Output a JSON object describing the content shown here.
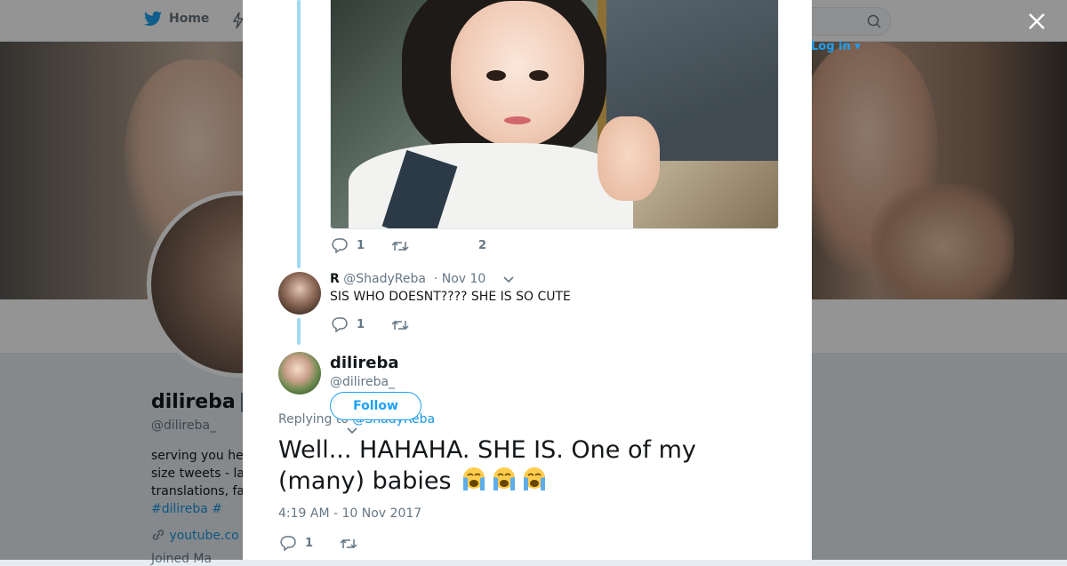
{
  "nav": {
    "home_label": "Home",
    "login_label": "Log in"
  },
  "profile": {
    "name": "dilireba",
    "handle": "@dilireba_",
    "bio_lines": [
      "serving you he",
      "size tweets - la",
      "translations, fa"
    ],
    "hashtags": "#dilireba #",
    "link": "youtube.co",
    "joined": "Joined Ma"
  },
  "modal": {
    "media_tweet_actions": {
      "reply_count": "1",
      "like_count": "2"
    },
    "reply_tweet": {
      "name": "R",
      "handle": "@ShadyReba",
      "date": "· Nov 10",
      "text": "SIS WHO DOESNT???? SHE IS SO CUTE",
      "reply_count": "1"
    },
    "main_tweet": {
      "name": "dilireba",
      "handle": "@dilireba_",
      "follow_label": "Follow",
      "replying_prefix": "Replying to",
      "replying_mention": "@ShadyReba",
      "text": "Well... HAHAHA. SHE IS. One of my (many) babies",
      "emojis": [
        "loudly-crying-face",
        "loudly-crying-face",
        "loudly-crying-face"
      ],
      "timestamp": "4:19 AM - 10 Nov 2017",
      "reply_count": "1"
    }
  },
  "colors": {
    "twitter_blue": "#1da1f2",
    "thread_line": "#a0d9f6",
    "text_gray": "#657786"
  }
}
